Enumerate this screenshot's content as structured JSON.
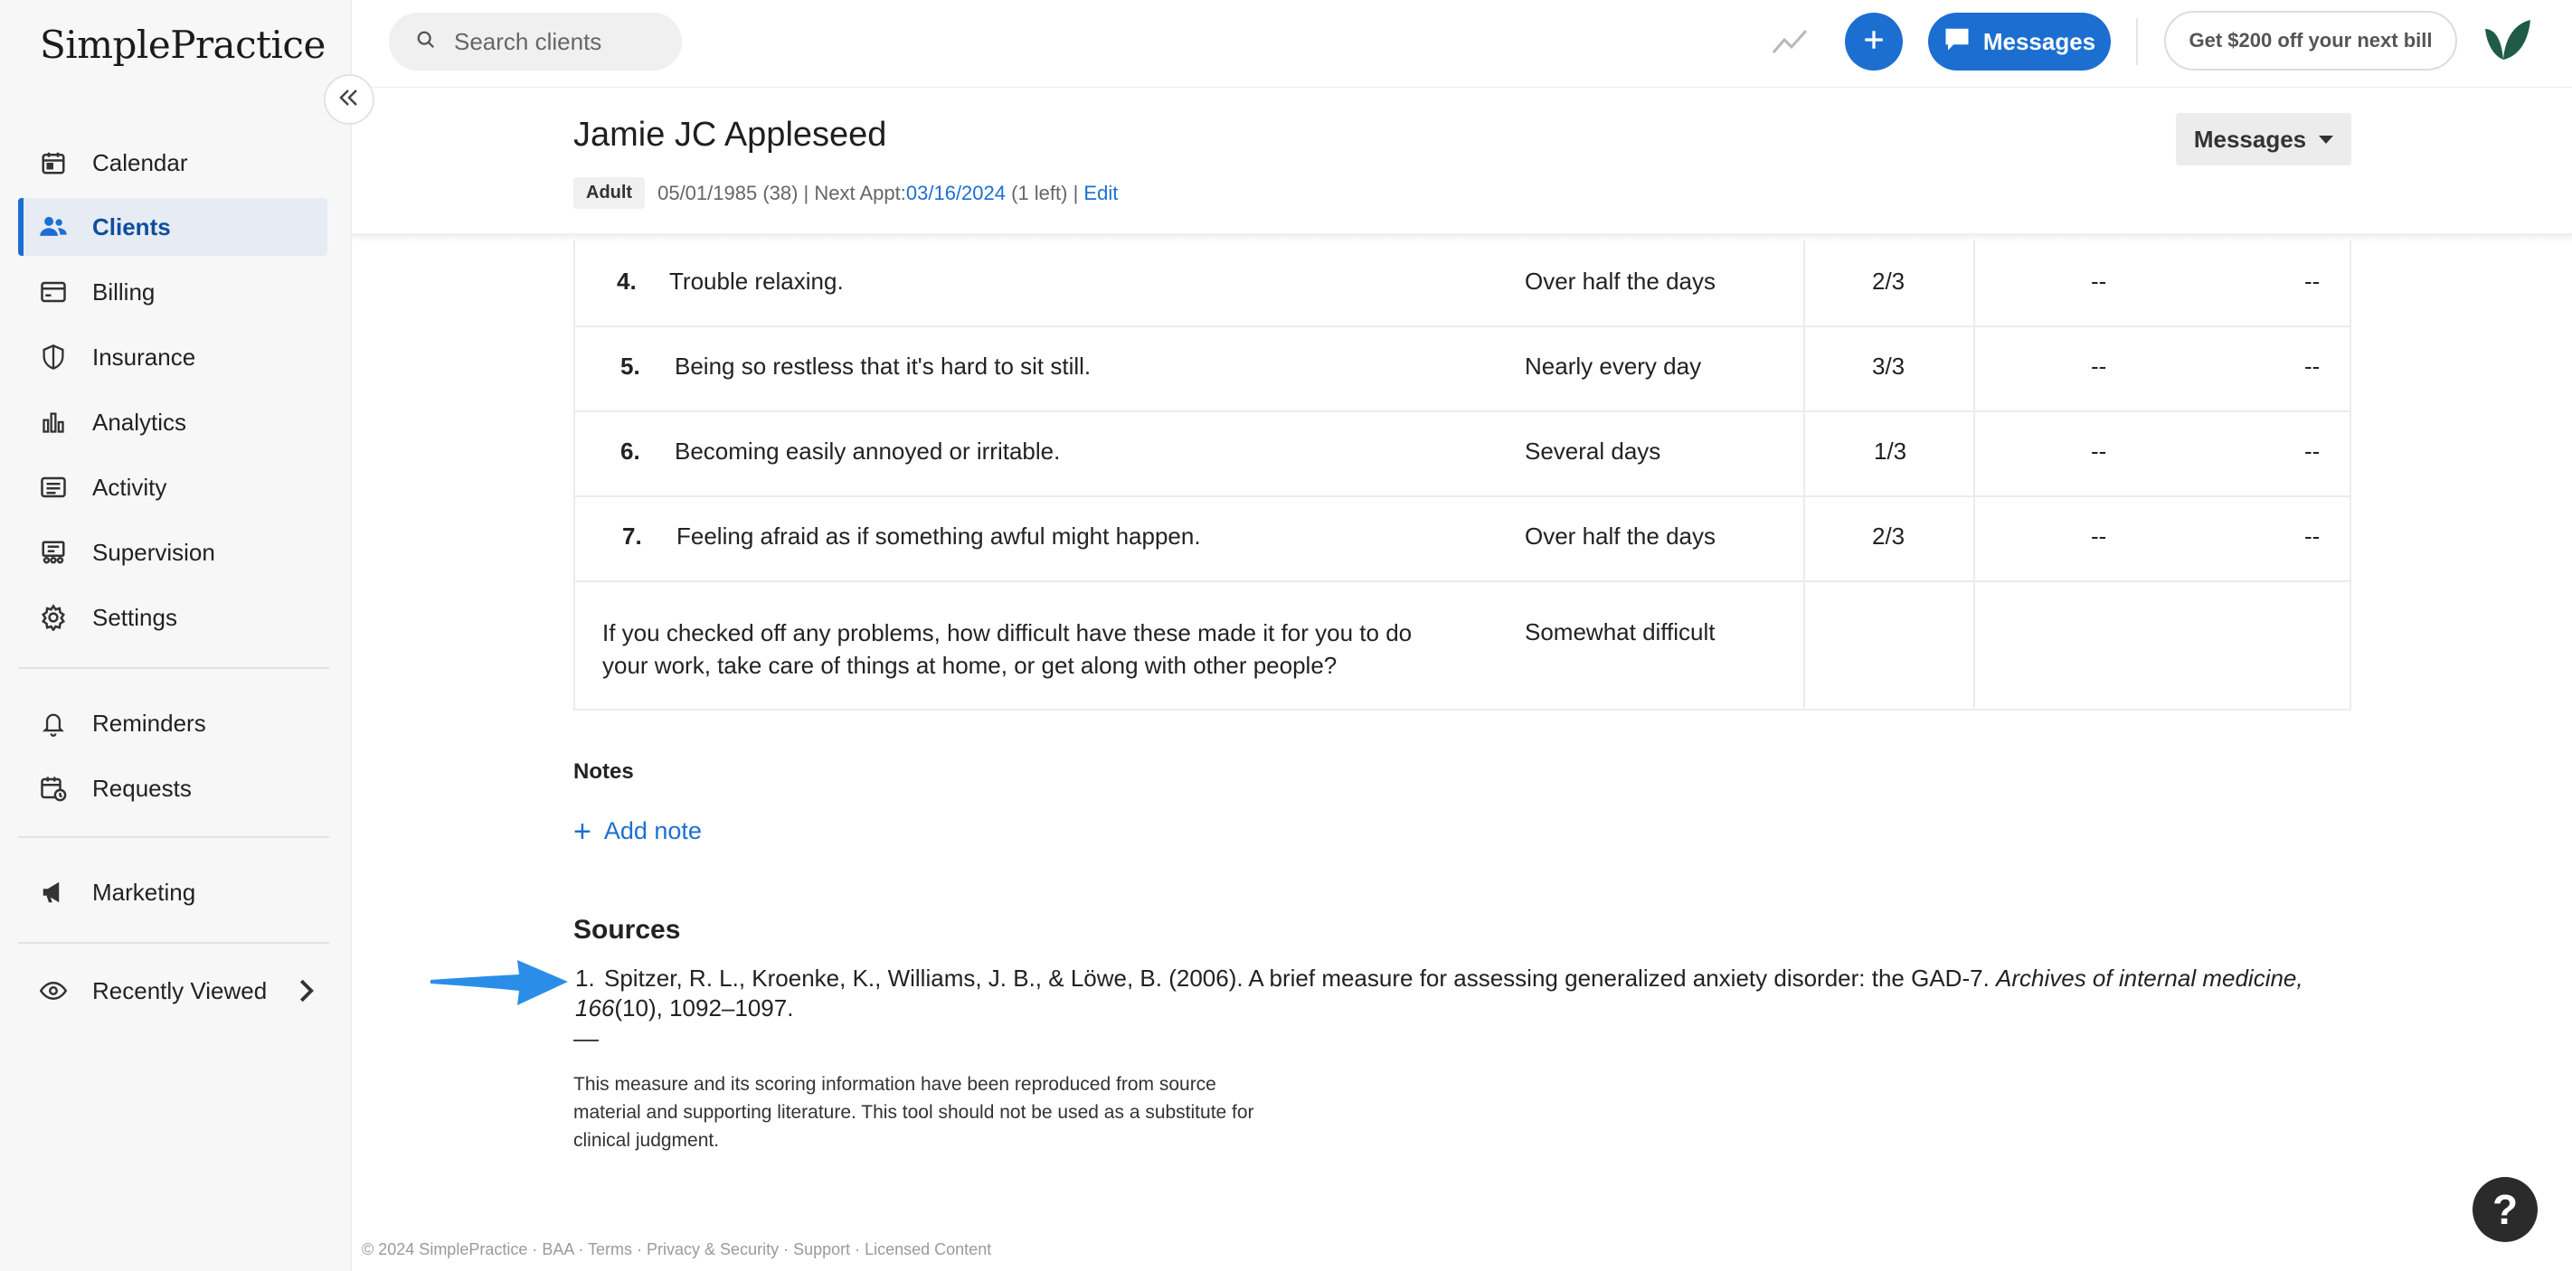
{
  "app": {
    "logo_text": "SimplePractice"
  },
  "sidebar": {
    "items": [
      {
        "label": "Calendar",
        "icon": "calendar-icon"
      },
      {
        "label": "Clients",
        "icon": "clients-icon",
        "active": true
      },
      {
        "label": "Billing",
        "icon": "credit-card-icon"
      },
      {
        "label": "Insurance",
        "icon": "shield-icon"
      },
      {
        "label": "Analytics",
        "icon": "bar-chart-icon"
      },
      {
        "label": "Activity",
        "icon": "list-icon"
      },
      {
        "label": "Supervision",
        "icon": "supervision-icon"
      },
      {
        "label": "Settings",
        "icon": "gear-icon"
      },
      {
        "label": "Reminders",
        "icon": "bell-icon"
      },
      {
        "label": "Requests",
        "icon": "calendar-clock-icon"
      },
      {
        "label": "Marketing",
        "icon": "megaphone-icon"
      },
      {
        "label": "Recently Viewed",
        "icon": "eye-icon"
      }
    ]
  },
  "topbar": {
    "search_placeholder": "Search clients",
    "messages_label": "Messages",
    "promo_label": "Get $200 off your next bill"
  },
  "client": {
    "name": "Jamie JC Appleseed",
    "badge": "Adult",
    "dob_text": "05/01/1985 (38) | Next Appt: ",
    "next_appt": "03/16/2024",
    "appt_suffix": " (1 left) | ",
    "edit_label": "Edit",
    "messages_dropdown": "Messages"
  },
  "table": {
    "rows": [
      {
        "num": "4.",
        "question": "Trouble relaxing.",
        "answer": "Over half the days",
        "score": "2/3",
        "d1": "--",
        "d2": "--"
      },
      {
        "num": "5.",
        "question": "Being so restless that it's hard to sit still.",
        "answer": "Nearly every day",
        "score": "3/3",
        "d1": "--",
        "d2": "--"
      },
      {
        "num": "6.",
        "question": "Becoming easily annoyed or irritable.",
        "answer": "Several days",
        "score": "1/3",
        "d1": "--",
        "d2": "--"
      },
      {
        "num": "7.",
        "question": "Feeling afraid as if something awful might happen.",
        "answer": "Over half the days",
        "score": "2/3",
        "d1": "--",
        "d2": "--"
      }
    ],
    "difficulty_question": "If you checked off any problems, how difficult have these made it for you to do your work, take care of things at home, or get along with other people?",
    "difficulty_answer": "Somewhat difficult"
  },
  "notes": {
    "heading": "Notes",
    "add_label": "Add note"
  },
  "sources": {
    "heading": "Sources",
    "index": "1.",
    "citation_main": "Spitzer, R. L., Kroenke, K., Williams, J. B., & Löwe, B. (2006). A brief measure for assessing generalized anxiety disorder: the GAD-7. ",
    "citation_journal": "Archives of internal medicine, 166",
    "citation_end": "(10), 1092–1097.",
    "disclaimer": "This measure and its scoring information have been reproduced from source material and supporting literature. This tool should not be used as a substitute for clinical judgment."
  },
  "footer": {
    "text": "© 2024 SimplePractice · BAA · Terms · Privacy & Security · Support · Licensed Content"
  },
  "colors": {
    "accent": "#1c6fd1",
    "arrow": "#2a8ee8"
  }
}
